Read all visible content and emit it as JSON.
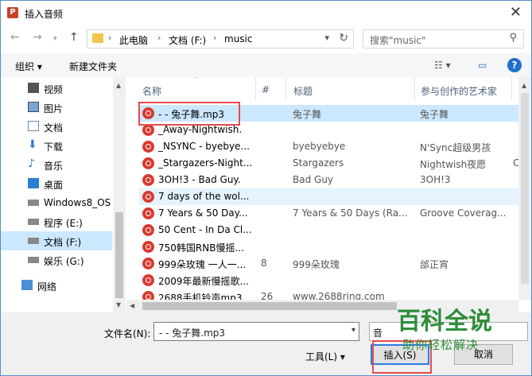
{
  "window": {
    "title": "插入音频",
    "app_icon": "P"
  },
  "address": {
    "crumbs": [
      "此电脑",
      "文档 (F:)",
      "music"
    ]
  },
  "search": {
    "placeholder": "搜索\"music\""
  },
  "toolbar": {
    "organize": "组织 ▾",
    "new_folder": "新建文件夹"
  },
  "sidebar": {
    "items": [
      {
        "label": "视频",
        "icon": "video-icon"
      },
      {
        "label": "图片",
        "icon": "picture-icon"
      },
      {
        "label": "文档",
        "icon": "document-icon"
      },
      {
        "label": "下载",
        "icon": "download-icon"
      },
      {
        "label": "音乐",
        "icon": "music-icon"
      },
      {
        "label": "桌面",
        "icon": "desktop-icon"
      },
      {
        "label": "Windows8_OS",
        "icon": "drive-icon"
      },
      {
        "label": "程序 (E:)",
        "icon": "drive-icon"
      },
      {
        "label": "文档 (F:)",
        "icon": "drive-icon"
      },
      {
        "label": "娱乐 (G:)",
        "icon": "drive-icon"
      },
      {
        "label": "网络",
        "icon": "network-icon"
      }
    ]
  },
  "columns": {
    "name": "名称",
    "num": "#",
    "title": "标题",
    "artist": "参与创作的艺术家"
  },
  "files": [
    {
      "name": "- - 兔子舞.mp3",
      "num": "",
      "title": "兔子舞",
      "artist": "兔子舞",
      "more": ""
    },
    {
      "name": "_Away-Nightwish.",
      "num": "",
      "title": "",
      "artist": "",
      "more": ""
    },
    {
      "name": "_NSYNC - byebye...",
      "num": "",
      "title": "byebyebye",
      "artist": "N'Sync超级男孩",
      "more": ""
    },
    {
      "name": "_Stargazers-Night...",
      "num": "",
      "title": "Stargazers",
      "artist": "Nightwish夜愿",
      "more": "C"
    },
    {
      "name": "3OH!3 - Bad Guy.",
      "num": "",
      "title": "Bad Guy",
      "artist": "3OH!3",
      "more": ""
    },
    {
      "name": "7 days of the wol...",
      "num": "",
      "title": "",
      "artist": "",
      "more": ""
    },
    {
      "name": "7 Years & 50 Day...",
      "num": "",
      "title": "7 Years & 50 Days (Ra...",
      "artist": "Groove Coverag...",
      "more": ""
    },
    {
      "name": "50 Cent - In Da Cl...",
      "num": "",
      "title": "",
      "artist": "",
      "more": ""
    },
    {
      "name": "750韩国RNB慢摇...",
      "num": "",
      "title": "",
      "artist": "",
      "more": ""
    },
    {
      "name": "999朵玫瑰 一人一...",
      "num": "8",
      "title": "999朵玫瑰",
      "artist": "邰正宵",
      "more": ""
    },
    {
      "name": "2009年最新慢摇歌...",
      "num": "",
      "title": "",
      "artist": "",
      "more": ""
    },
    {
      "name": "2688手机铃声mp3...",
      "num": "26",
      "title": "www.2688ring.com",
      "artist": "",
      "more": ""
    }
  ],
  "footer": {
    "filename_label": "文件名(N):",
    "filename_value": "- - 兔子舞.mp3",
    "type_value": "音",
    "tools_label": "工具(L)  ▾",
    "insert_label": "插入(S)",
    "cancel_label": "取消"
  },
  "watermark": {
    "line1": "百科全说",
    "line2": "助你轻松解决"
  }
}
